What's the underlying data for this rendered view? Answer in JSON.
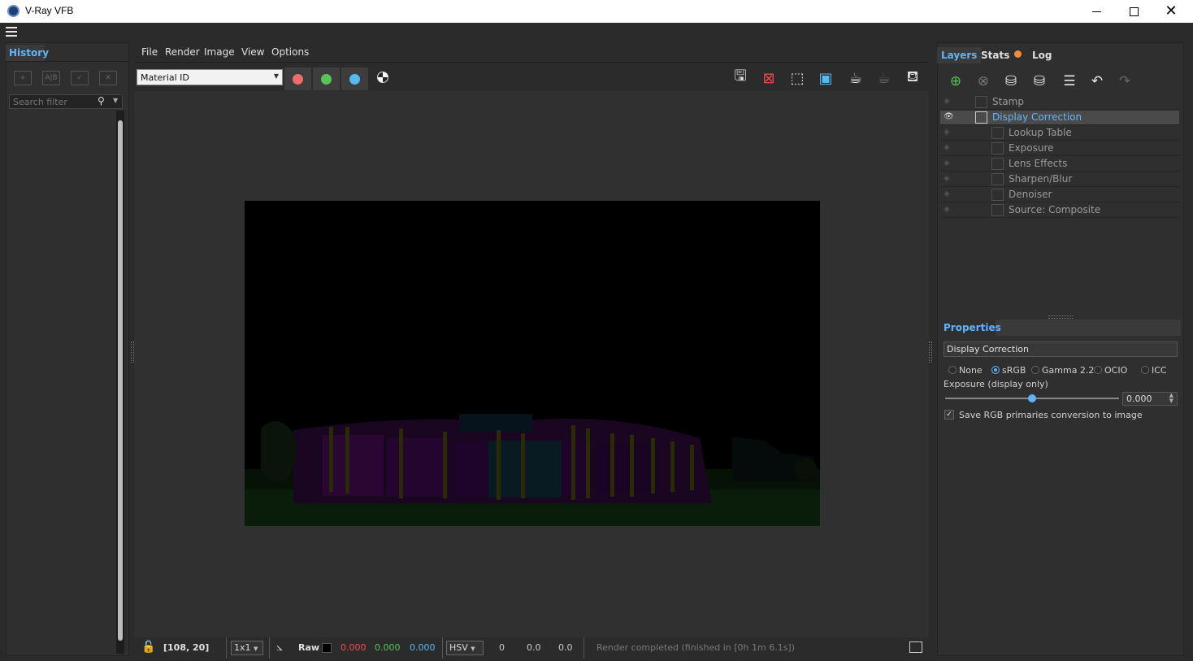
{
  "window": {
    "title": "V-Ray VFB",
    "controls": [
      "minimize-icon",
      "maximize-icon",
      "close-icon"
    ]
  },
  "history": {
    "tab": "History",
    "search_placeholder": "Search filter"
  },
  "menu": {
    "items": [
      "File",
      "Render",
      "Image",
      "View",
      "Options"
    ]
  },
  "toolbar": {
    "channel": "Material ID",
    "channel_colors": {
      "red": "#ef6b6b",
      "green": "#58c458",
      "blue": "#5ab8f0"
    }
  },
  "status": {
    "coords": "[108, 20]",
    "zoom": "1x1",
    "mode": "Raw",
    "r": "0.000",
    "g": "0.000",
    "b": "0.000",
    "color_space": "HSV",
    "h": "0",
    "s": "0.0",
    "v": "0.0",
    "message": "Render completed (finished in [0h  1m  6.1s])"
  },
  "right_tabs": {
    "layers": "Layers",
    "stats": "Stats",
    "log": "Log"
  },
  "layers": [
    {
      "label": "Stamp"
    },
    {
      "label": "Display Correction"
    },
    {
      "label": "Lookup Table"
    },
    {
      "label": "Exposure"
    },
    {
      "label": "Lens Effects"
    },
    {
      "label": "Sharpen/Blur"
    },
    {
      "label": "Denoiser"
    },
    {
      "label": "Source: Composite"
    }
  ],
  "properties": {
    "tab": "Properties",
    "name": "Display Correction",
    "options": [
      "None",
      "sRGB",
      "Gamma 2.2",
      "OCIO",
      "ICC"
    ],
    "selected": "sRGB",
    "exposure_label": "Exposure (display only)",
    "exposure_value": "0.000",
    "exposure_level": 0.5,
    "save_rgb_label": "Save RGB primaries conversion to image"
  }
}
